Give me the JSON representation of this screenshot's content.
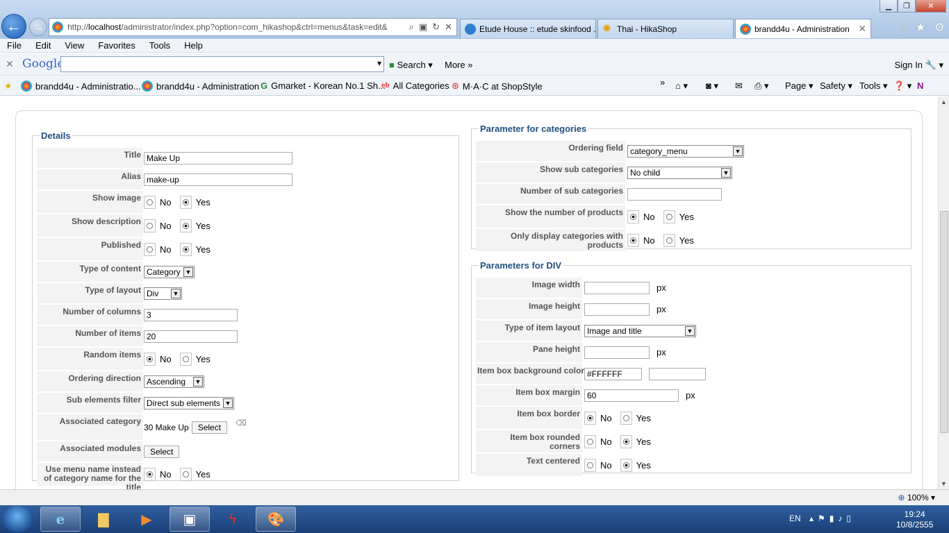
{
  "browser": {
    "address_prefix": "http://",
    "address_host": "localhost",
    "address_path": "/administrator/index.php?option=com_hikashop&ctrl=menus&task=edit&",
    "tabs": [
      {
        "label": "Etude House :: etude skinfood ..."
      },
      {
        "label": "Thai - HikaShop"
      },
      {
        "label": "brandd4u - Administration"
      }
    ],
    "menu": [
      "File",
      "Edit",
      "View",
      "Favorites",
      "Tools",
      "Help"
    ],
    "google_label": "Google",
    "google_search": "Search",
    "google_more": "More",
    "sign_in": "Sign In",
    "favorites": [
      "brandd4u - Administratio...",
      "brandd4u - Administration",
      "Gmarket - Korean No.1 Sh...",
      "All Categories",
      "M·A·C at ShopStyle"
    ],
    "commands": {
      "page": "Page",
      "safety": "Safety",
      "tools": "Tools"
    },
    "zoom": "100%"
  },
  "details": {
    "legend": "Details",
    "title_label": "Title",
    "title_value": "Make Up",
    "alias_label": "Alias",
    "alias_value": "make-up",
    "show_image_label": "Show image",
    "show_description_label": "Show description",
    "published_label": "Published",
    "type_content_label": "Type of content",
    "type_content_value": "Category",
    "type_layout_label": "Type of layout",
    "type_layout_value": "Div",
    "columns_label": "Number of columns",
    "columns_value": "3",
    "items_label": "Number of items",
    "items_value": "20",
    "random_label": "Random items",
    "ordering_label": "Ordering direction",
    "ordering_value": "Ascending",
    "sub_filter_label": "Sub elements filter",
    "sub_filter_value": "Direct sub elements",
    "assoc_cat_label": "Associated category",
    "assoc_cat_value": "30 Make Up",
    "assoc_mod_label": "Associated modules",
    "menu_name_label": "Use menu name instead of category name for the title",
    "select_label": "Select",
    "no": "No",
    "yes": "Yes"
  },
  "categories": {
    "legend": "Parameter for categories",
    "ordering_label": "Ordering field",
    "ordering_value": "category_menu",
    "sub_label": "Show sub categories",
    "sub_value": "No child",
    "num_sub_label": "Number of sub categories",
    "num_sub_value": "",
    "show_num_label": "Show the number of products",
    "only_label": "Only display categories with products"
  },
  "div": {
    "legend": "Parameters for DIV",
    "img_w_label": "Image width",
    "img_w_value": "",
    "img_h_label": "Image height",
    "img_h_value": "",
    "layout_label": "Type of item layout",
    "layout_value": "Image and title",
    "pane_label": "Pane height",
    "pane_value": "",
    "bg_label": "Item box background color",
    "bg_value": "#FFFFFF",
    "margin_label": "Item box margin",
    "margin_value": "60",
    "border_label": "Item box border",
    "rounded_label": "Item box rounded corners",
    "centered_label": "Text centered",
    "px": "px"
  },
  "taskbar": {
    "lang": "EN",
    "time": "19:24",
    "date": "10/8/2555"
  }
}
